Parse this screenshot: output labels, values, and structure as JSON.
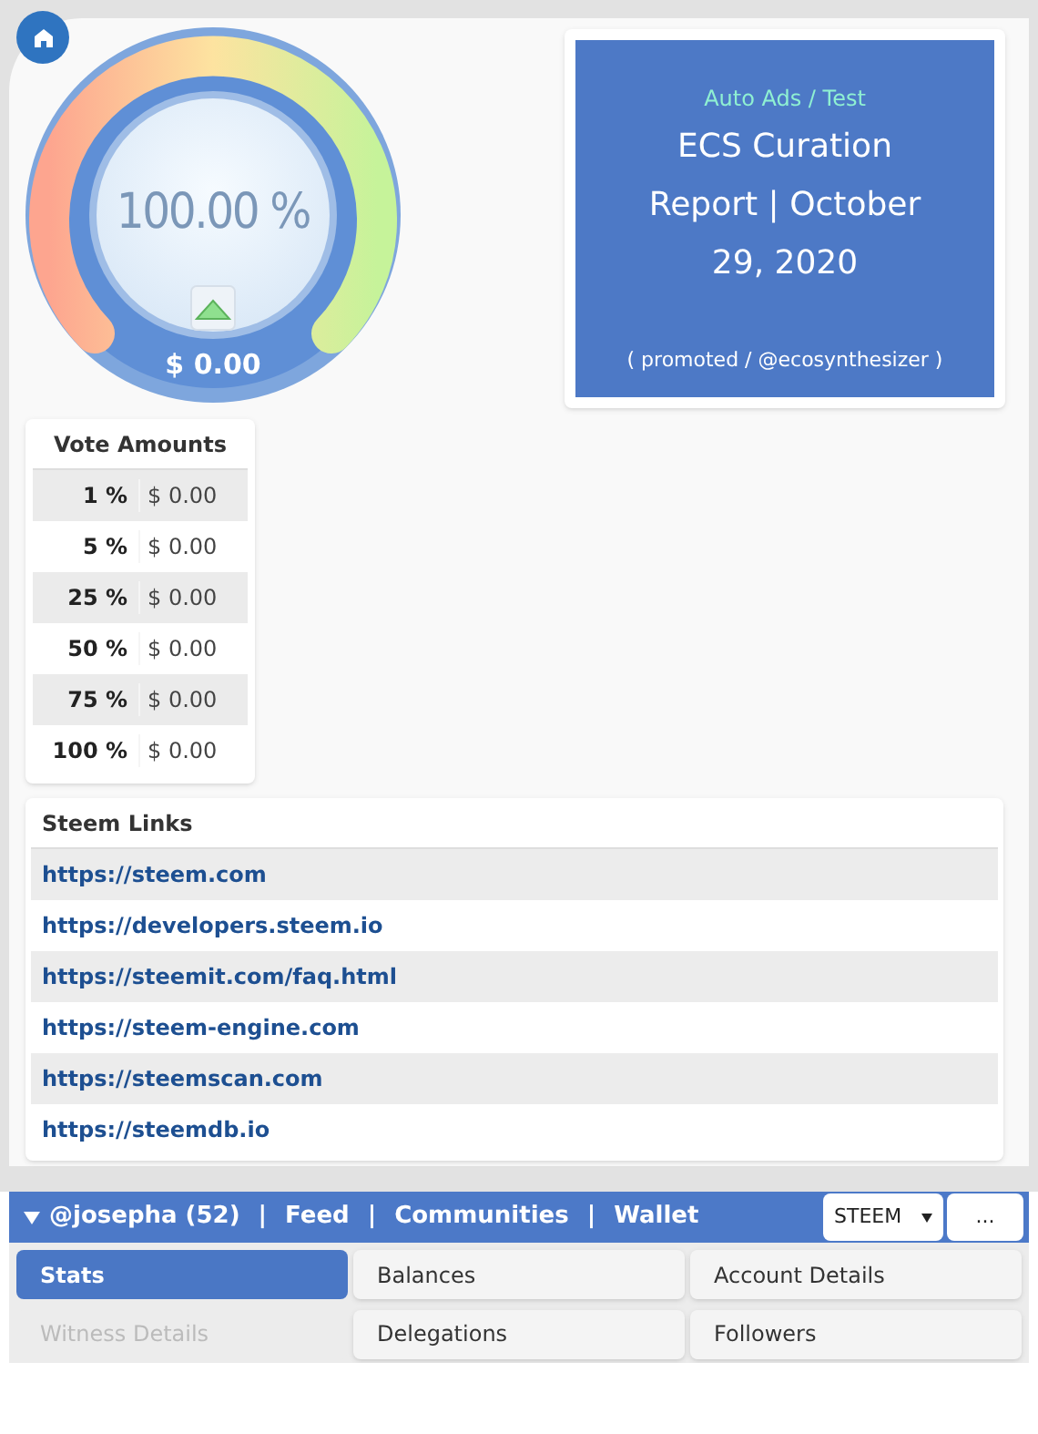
{
  "gauge": {
    "percent": "100.00 %",
    "value": "$ 0.00"
  },
  "ad": {
    "category": "Auto Ads / Test",
    "title": "ECS Curation Report | October 29, 2020",
    "byline": "( promoted / @ecosynthesizer )"
  },
  "vote_amounts": {
    "title": "Vote Amounts",
    "rows": [
      {
        "percent": "1 %",
        "amount": "$ 0.00"
      },
      {
        "percent": "5 %",
        "amount": "$ 0.00"
      },
      {
        "percent": "25 %",
        "amount": "$ 0.00"
      },
      {
        "percent": "50 %",
        "amount": "$ 0.00"
      },
      {
        "percent": "75 %",
        "amount": "$ 0.00"
      },
      {
        "percent": "100 %",
        "amount": "$ 0.00"
      }
    ]
  },
  "steem_links": {
    "title": "Steem Links",
    "links": [
      "https://steem.com",
      "https://developers.steem.io",
      "https://steemit.com/faq.html",
      "https://steem-engine.com",
      "https://steemscan.com",
      "https://steemdb.io"
    ]
  },
  "nav_bar": {
    "user": "@josepha (52)",
    "items": [
      {
        "kind": "separator",
        "text": "|"
      },
      {
        "kind": "link",
        "text": "Feed"
      },
      {
        "kind": "separator",
        "text": "|"
      },
      {
        "kind": "link",
        "text": "Communities"
      },
      {
        "kind": "separator",
        "text": "|"
      },
      {
        "kind": "link",
        "text": "Wallet"
      }
    ],
    "currency": "STEEM",
    "more": "..."
  },
  "tabs": [
    {
      "label": "Stats",
      "selected": true,
      "disabled": false
    },
    {
      "label": "Balances",
      "selected": false,
      "disabled": false
    },
    {
      "label": "Account Details",
      "selected": false,
      "disabled": false
    },
    {
      "label": "Witness Details",
      "selected": false,
      "disabled": true
    },
    {
      "label": "Delegations",
      "selected": false,
      "disabled": false
    },
    {
      "label": "Followers",
      "selected": false,
      "disabled": false
    }
  ]
}
